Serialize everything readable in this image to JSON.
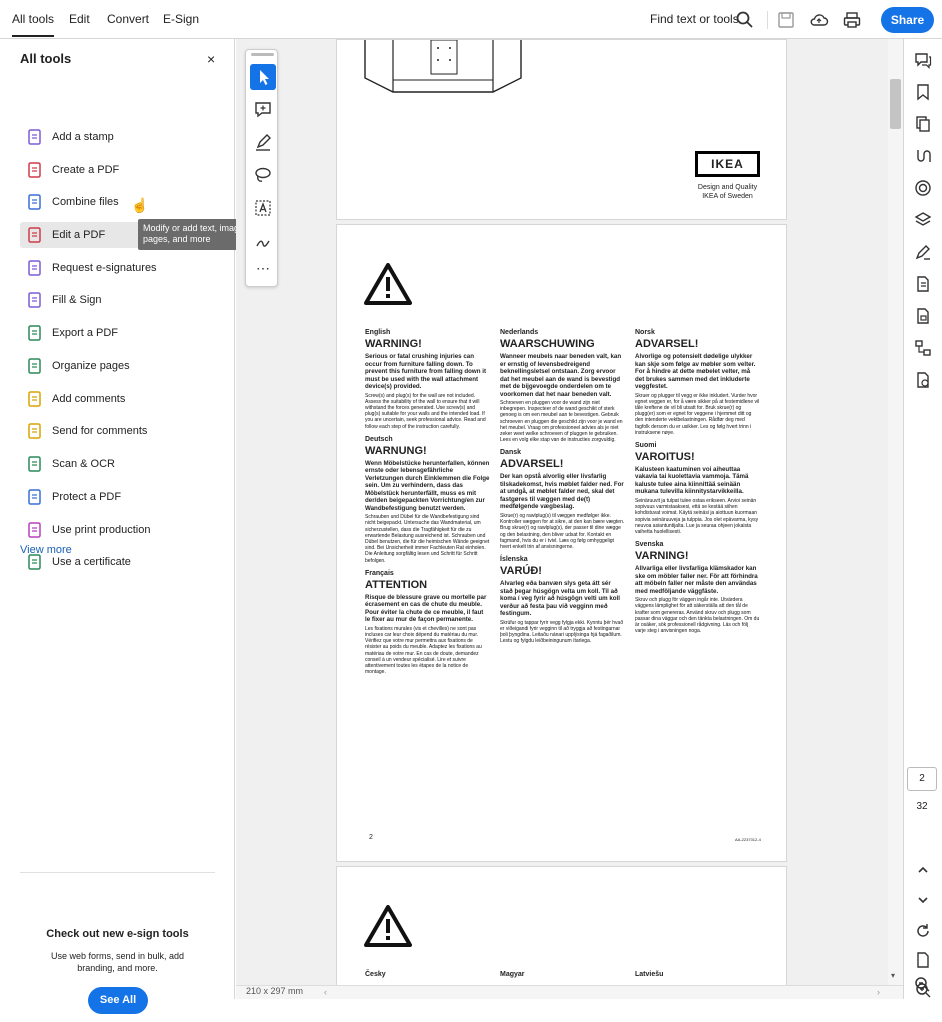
{
  "topbar": {
    "tabs": [
      "All tools",
      "Edit",
      "Convert",
      "E-Sign"
    ],
    "find_label": "Find text or tools",
    "share_label": "Share"
  },
  "panel": {
    "title": "All tools",
    "close": "×",
    "tools": [
      {
        "label": "Add a stamp",
        "icon": "stamp-icon",
        "color": "#7b5bd6"
      },
      {
        "label": "Create a PDF",
        "icon": "create-pdf-icon",
        "color": "#d1394a"
      },
      {
        "label": "Combine files",
        "icon": "combine-files-icon",
        "color": "#3a6fd6"
      },
      {
        "label": "Edit a PDF",
        "icon": "edit-pdf-icon",
        "color": "#d1394a"
      },
      {
        "label": "Request e-signatures",
        "icon": "request-signature-icon",
        "color": "#7b5bd6"
      },
      {
        "label": "Fill & Sign",
        "icon": "fill-sign-icon",
        "color": "#7b5bd6"
      },
      {
        "label": "Export a PDF",
        "icon": "export-pdf-icon",
        "color": "#2a8a5a"
      },
      {
        "label": "Organize pages",
        "icon": "organize-pages-icon",
        "color": "#2a8a5a"
      },
      {
        "label": "Add comments",
        "icon": "add-comments-icon",
        "color": "#d8a400"
      },
      {
        "label": "Send for comments",
        "icon": "send-comments-icon",
        "color": "#d8a400"
      },
      {
        "label": "Scan & OCR",
        "icon": "scan-ocr-icon",
        "color": "#2a8a5a"
      },
      {
        "label": "Protect a PDF",
        "icon": "protect-pdf-icon",
        "color": "#3a6fd6"
      },
      {
        "label": "Use print production",
        "icon": "print-production-icon",
        "color": "#b83fbf"
      },
      {
        "label": "Use a certificate",
        "icon": "certificate-icon",
        "color": "#2a8a5a"
      }
    ],
    "view_more": "View more",
    "tooltip": "Modify or add text, images, pages, and more",
    "promo": {
      "heading": "Check out new e-sign tools",
      "text": "Use web forms, send in bulk, add branding, and more.",
      "button": "See All"
    }
  },
  "page1": {
    "ikea_logo": "IKEA",
    "ikea_caption_1": "Design and Quality",
    "ikea_caption_2": "IKEA of Sweden"
  },
  "page2": {
    "page_number": "2",
    "doc_code": "AA-2237012-4",
    "columns": [
      [
        {
          "lang": "English",
          "warn": "WARNING!",
          "bold": "Serious or fatal crushing injuries can occur from furniture falling down. To prevent this furniture from falling down it must be used with the wall attachment device(s) provided.",
          "small": "Screw(s) and plug(s) for the wall are not included. Assess the suitability of the wall to ensure that it will withstand the forces generated. Use screw(s) and plug(s) suitable for your walls and the intended load. If you are uncertain, seek professional advice. Read and follow each step of the instruction carefully."
        },
        {
          "lang": "Deutsch",
          "warn": "WARNUNG!",
          "bold": "Wenn Möbelstücke herunterfallen, können ernste oder lebensgefährliche Verletzungen durch Einklemmen die Folge sein. Um zu verhindern, dass das Möbelstück herunterfällt, muss es mit der/den beigepackten Vorrichtung/en zur Wandbefestigung benutzt werden.",
          "small": "Schrauben und Dübel für die Wandbefestigung sind nicht beigepackt. Untersuche das Wandmaterial, um sicherzustellen, dass die Tragfähigkeit für die zu erwartende Belastung ausreichend ist. Schrauben und Dübel benutzen, die für die heimischen Wände geeignet sind. Bei Unsicherheit immer Fachleuten Rat einholen. Die Anleitung sorgfältig lesen und Schritt für Schritt befolgen."
        },
        {
          "lang": "Français",
          "warn": "ATTENTION",
          "bold": "Risque de blessure grave ou mortelle par écrasement en cas de chute du meuble. Pour éviter la chute de ce meuble, il faut le fixer au mur de façon permanente.",
          "small": "Les fixations murales (vis et chevilles) ne sont pas incluses car leur choix dépend du matériau du mur. Vérifiez que votre mur permettra aux fixations de résister au poids du meuble. Adaptez les fixations au matériau de votre mur. En cas de doute, demandez conseil à un vendeur spécialisé. Lire et suivre attentivement toutes les étapes de la notice de montage."
        }
      ],
      [
        {
          "lang": "Nederlands",
          "warn": "WAARSCHUWING",
          "bold": "Wanneer meubels naar beneden valt, kan er ernstig of levensbedreigend beknellingsletsel ontstaan. Zorg ervoor dat het meubel aan de wand is bevestigd met de bijgevoegde onderdelen om te voorkomen dat het naar beneden valt.",
          "small": "Schroeven en pluggen voor de wand zijn niet inbegrepen. Inspecteer of de wand geschikt of sterk genoeg is om een meubel aan te bevestigen. Gebruik schroeven en pluggen die geschikt zijn voor je wand en het meubel. Vraag om professioneel advies als je niet zeker weet welke schroeven of pluggen te gebruiken. Lees en volg elke stap van de instructies zorgvuldig."
        },
        {
          "lang": "Dansk",
          "warn": "ADVARSEL!",
          "bold": "Der kan opstå alvorlig eller livsfarlig tilskadekomst, hvis møblet falder ned. For at undgå, at møblet falder ned, skal det fastgøres til væggen med de(t) medfølgende vægbeslag.",
          "small": "Skrue(r) og rawlplug(s) til væggen medfølger ikke. Kontroller væggen for at sikre, at den kan bære vægten. Brug skrue(r) og rawlplug(s), der passer til dine vægge og den belastning, den bliver udsat for. Kontakt en fagmand, hvis du er i tvivl. Læs og følg omhyggeligt hvert enkelt trin af anvisningerne."
        },
        {
          "lang": "Íslenska",
          "warn": "VARÚÐ!",
          "bold": "Alvarleg eða banvæn slys geta átt sér stað þegar húsgögn velta um koll. Til að koma í veg fyrir að húsgögn velti um koll verður að festa þau við vegginn með festingum.",
          "small": "Skrúfur og tappar fyrir vegg fylgja ekki. Kynntu þér hvað er viðeigandi fyrir vegginn til að tryggja að festingarnar þoli þyngdina. Leitaðu nánari upplýsinga hjá fagaðilum. Lestu og fylgdu leiðbeiningunum ítarlega."
        }
      ],
      [
        {
          "lang": "Norsk",
          "warn": "ADVARSEL!",
          "bold": "Alvorlige og potensielt dødelige ulykker kan skje som følge av møbler som velter. For å hindre at dette møbelet velter, må det brukes sammen med det inkluderte veggfestet.",
          "small": "Skruer og plugger til vegg er ikke inkludert. Vurder hvor egnet veggen er, for å være sikker på at festemidlene vil tåle kreftene de vil bli utsatt for. Bruk skrue(r) og plugg(er) som er egnet for veggene i hjemmet ditt og den intenderte vektbelastningen. Rådfør deg med fagfolk dersom du er usikker. Les og følg hvert trinn i instruksene nøye."
        },
        {
          "lang": "Suomi",
          "warn": "VAROITUS!",
          "bold": "Kalusteen kaatuminen voi aiheuttaa vakavia tai kuolettavia vammoja. Tämä kaluste tulee aina kiinnittää seinään mukana tulevilla kiinnitystarvikkeilla.",
          "small": "Seinäruuvit ja tulpat tulee ostaa erikseen. Arvioi seinän sopivuus varmistaaksesi, että se kestää siihen kohdistuvat voimat. Käytä seinäsi ja aiottuun kuormaan sopivia seinäruuveja ja tulppia. Jos olet epävarma, kysy neuvoa asiantuntijalta. Lue ja seuraa ohjeen jokaista vaihetta huolellisesti."
        },
        {
          "lang": "Svenska",
          "warn": "VARNING!",
          "bold": "Allvarliga eller livsfarliga klämskador kan ske om möbler faller ner. För att förhindra att möbeln faller ner måste den användas med medföljande väggfäste.",
          "small": "Skruv och plugg för väggen ingår inte. Utvärdera väggens lämplighet för att säkerställa att den tål de krafter som genereras. Använd skruv och plugg som passar dina väggar och den tänkta belastningen. Om du är osäker, sök professionell rådgivning. Läs och följ varje steg i anvisningen noga."
        }
      ]
    ]
  },
  "page3": {
    "langs": [
      "Česky",
      "Magyar",
      "Latviešu"
    ]
  },
  "status": {
    "dimensions": "210 x 297 mm",
    "current_page": "2",
    "total_pages": "32"
  }
}
